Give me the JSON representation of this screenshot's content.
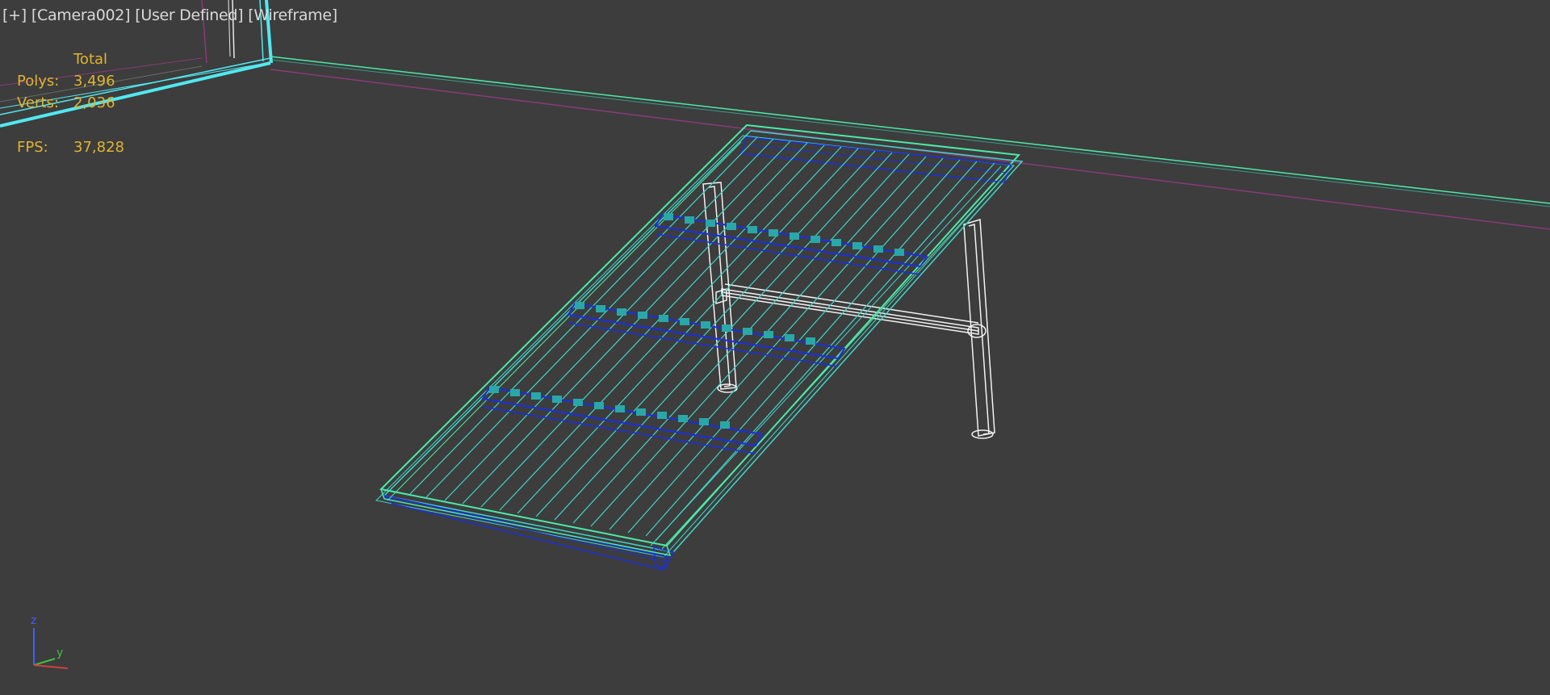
{
  "viewport": {
    "labels": [
      {
        "name": "viewport-menu-plus",
        "text": "[+]"
      },
      {
        "name": "viewport-camera-label",
        "text": "[Camera002]"
      },
      {
        "name": "viewport-view-label",
        "text": "[User Defined]"
      },
      {
        "name": "viewport-shading-label",
        "text": "[Wireframe]"
      }
    ],
    "background_color": "#3d3d3d"
  },
  "stats": {
    "header": "Total",
    "polys_label": "Polys:",
    "polys_value": "3,496",
    "verts_label": "Verts:",
    "verts_value": "2,036",
    "fps_label": "FPS:",
    "fps_value": "37,828",
    "color": "#e0b430"
  },
  "axis_gizmo": {
    "z_label": "z",
    "y_label": "y",
    "x_color": "#d04040",
    "y_color": "#40c040",
    "z_color": "#4060ff"
  },
  "colors": {
    "wire_cyan": "#3fd6c8",
    "wire_green": "#4de8a8",
    "wire_blue": "#1a2fe0",
    "wire_white": "#f2f2f2",
    "wall_magenta": "#8a3a7a",
    "wall_cyan": "#52e8f0"
  }
}
